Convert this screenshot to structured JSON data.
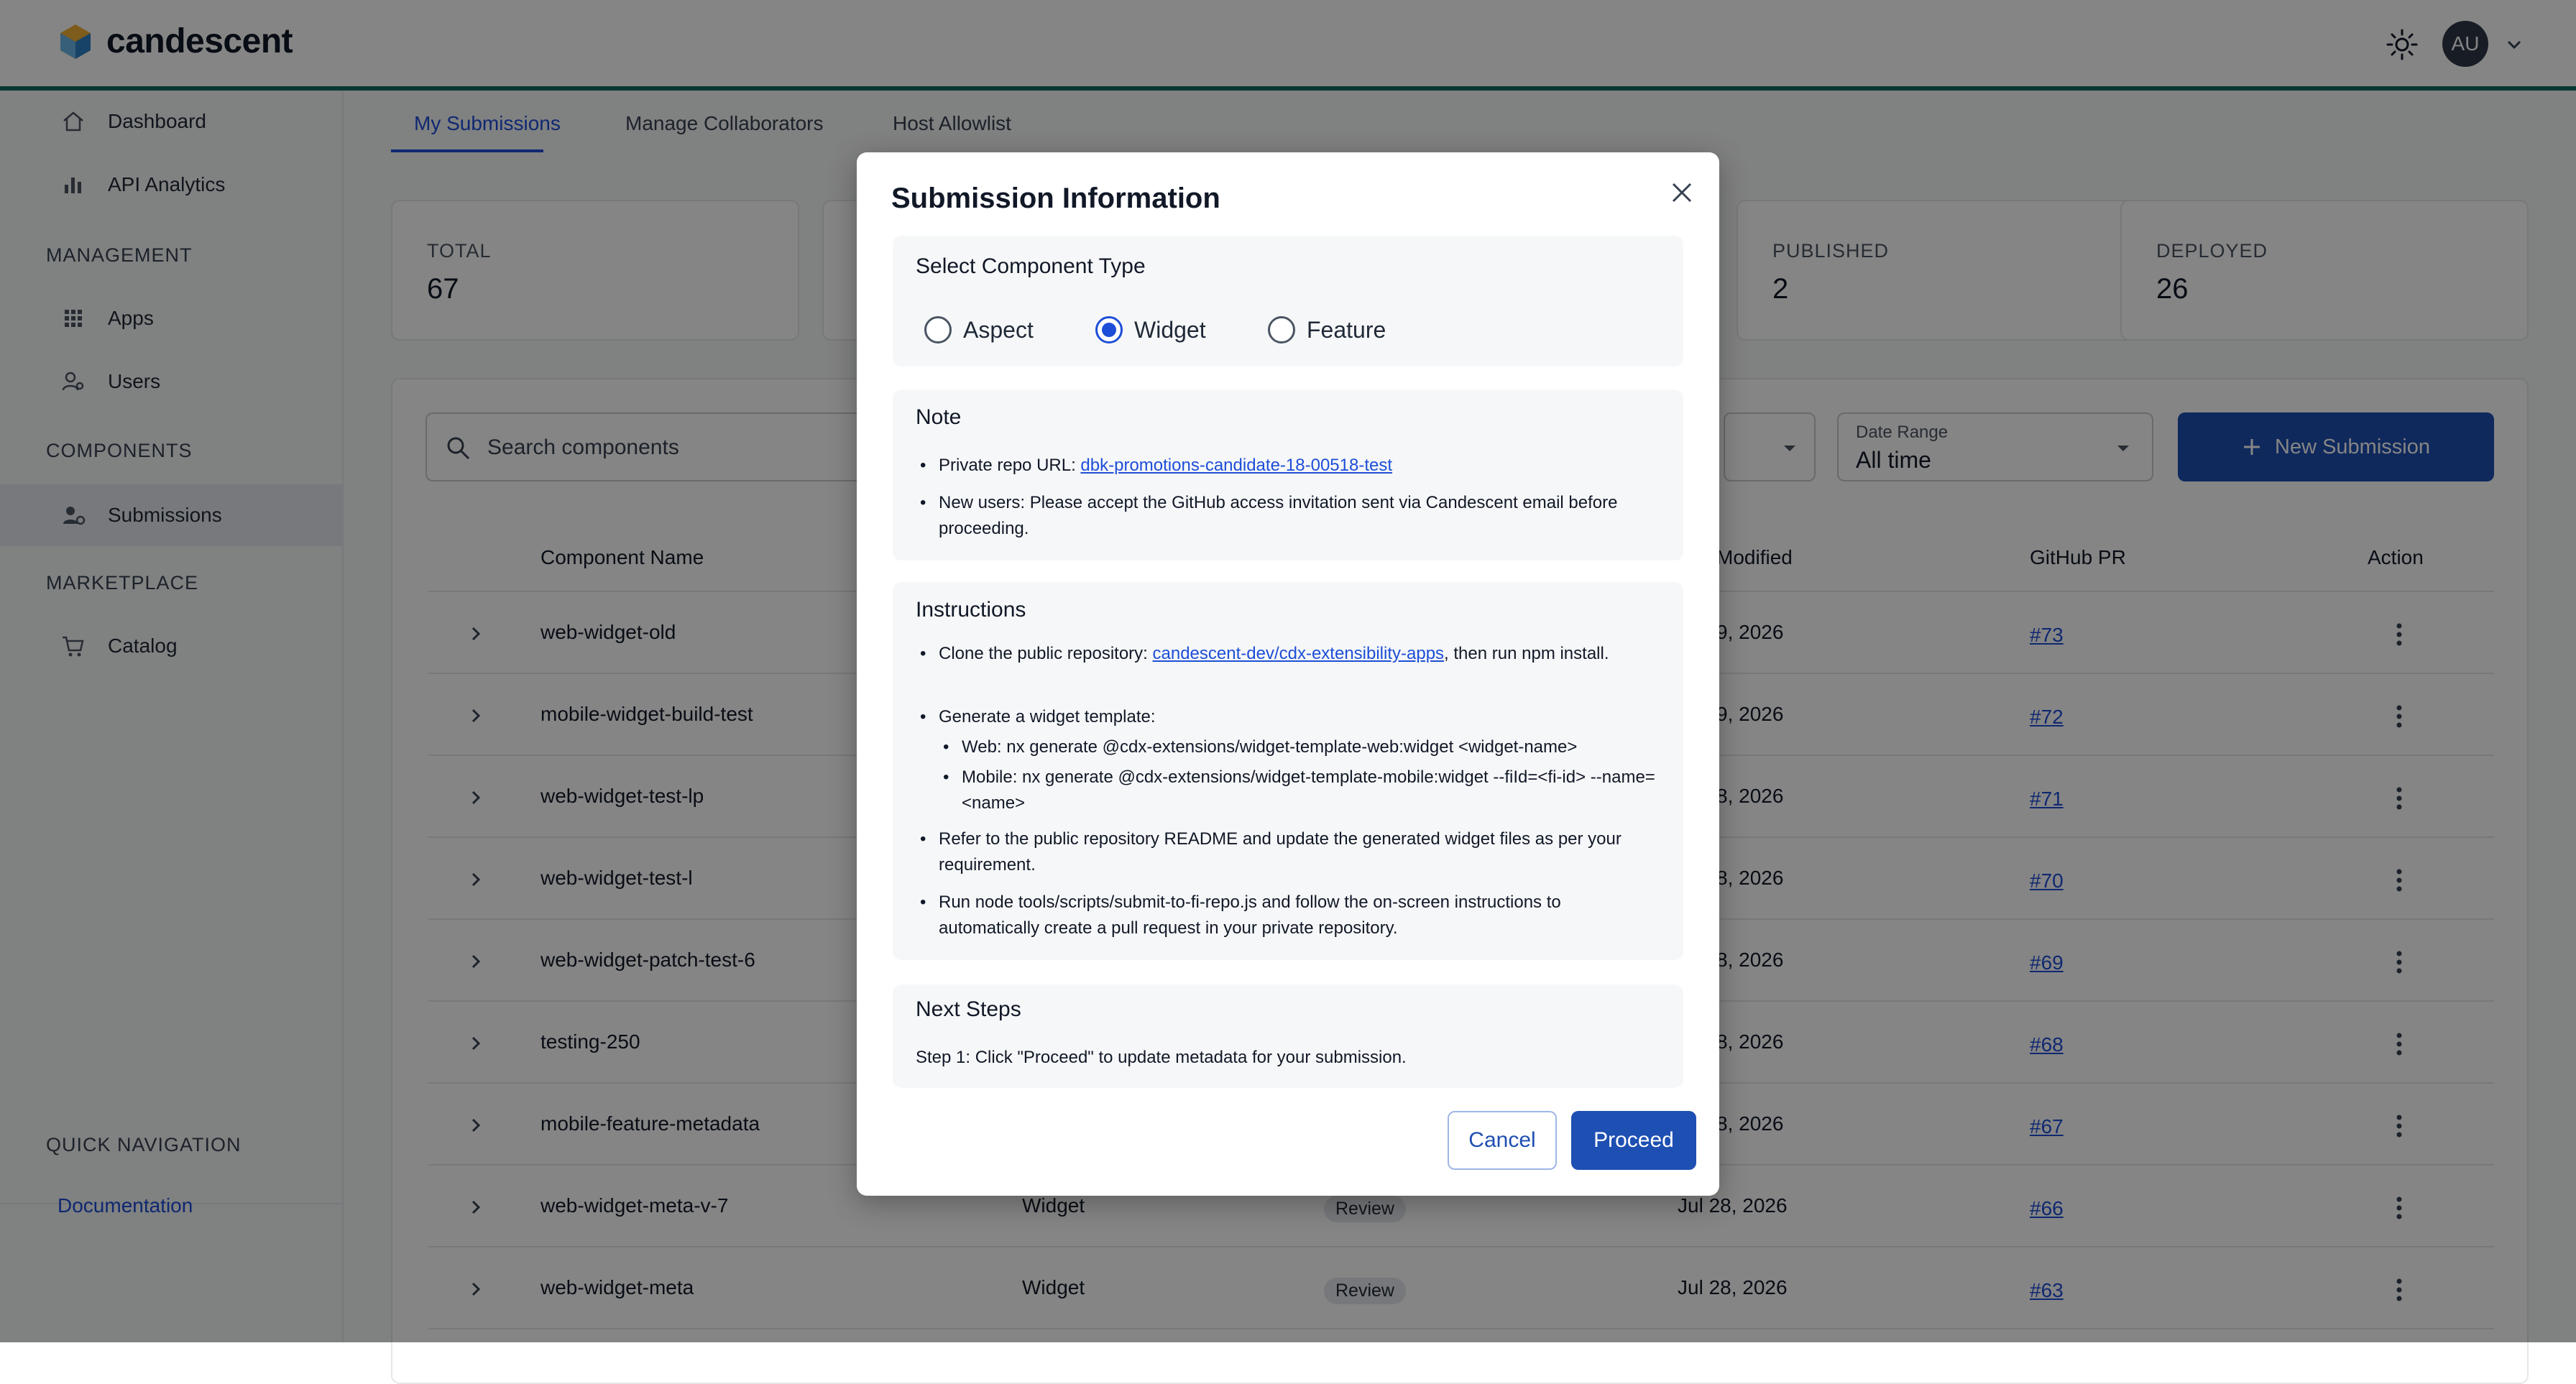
{
  "app": {
    "brand": "candescent",
    "avatar_initials": "AU",
    "accent_color": "#1e4fb2",
    "header_line_color": "#0e6b63"
  },
  "sidebar": {
    "items_top": [
      {
        "label": "Dashboard",
        "icon": "home-icon"
      },
      {
        "label": "API Analytics",
        "icon": "bar-chart-icon"
      }
    ],
    "management_label": "MANAGEMENT",
    "management_items": [
      {
        "label": "Apps",
        "icon": "grid-icon"
      },
      {
        "label": "Users",
        "icon": "users-icon"
      }
    ],
    "components_label": "COMPONENTS",
    "components_items": [
      {
        "label": "Submissions",
        "icon": "user-gear-icon"
      }
    ],
    "marketplace_label": "MARKETPLACE",
    "marketplace_items": [
      {
        "label": "Catalog",
        "icon": "cart-icon"
      }
    ],
    "quick_nav_label": "QUICK NAVIGATION",
    "documentation_link": "Documentation"
  },
  "tabs": [
    "My Submissions",
    "Manage Collaborators",
    "Host Allowlist"
  ],
  "stats": [
    {
      "title": "TOTAL",
      "value": "67"
    },
    {
      "title": "PUBLISHED",
      "value": "2"
    },
    {
      "title": "DEPLOYED",
      "value": "26"
    }
  ],
  "toolbar": {
    "search_placeholder": "Search components",
    "date_range_label": "Date Range",
    "date_range_value": "All time",
    "new_submission_label": "New Submission"
  },
  "table": {
    "headers": {
      "name": "Component Name",
      "modified": "Modified",
      "pr": "GitHub PR",
      "action": "Action"
    },
    "rows": [
      {
        "name": "web-widget-old",
        "type": "",
        "status": "",
        "modified": "9, 2026",
        "pr": "#73"
      },
      {
        "name": "mobile-widget-build-test",
        "type": "",
        "status": "",
        "modified": "9, 2026",
        "pr": "#72"
      },
      {
        "name": "web-widget-test-lp",
        "type": "",
        "status": "",
        "modified": "8, 2026",
        "pr": "#71"
      },
      {
        "name": "web-widget-test-l",
        "type": "",
        "status": "",
        "modified": "8, 2026",
        "pr": "#70"
      },
      {
        "name": "web-widget-patch-test-6",
        "type": "",
        "status": "",
        "modified": "8, 2026",
        "pr": "#69"
      },
      {
        "name": "testing-250",
        "type": "",
        "status": "",
        "modified": "8, 2026",
        "pr": "#68"
      },
      {
        "name": "mobile-feature-metadata",
        "type": "",
        "status": "",
        "modified": "8, 2026",
        "pr": "#67"
      },
      {
        "name": "web-widget-meta-v-7",
        "type": "Widget",
        "status": "Review",
        "modified": "Jul 28, 2026",
        "pr": "#66"
      },
      {
        "name": "web-widget-meta",
        "type": "Widget",
        "status": "Review",
        "modified": "Jul 28, 2026",
        "pr": "#63"
      }
    ]
  },
  "modal": {
    "title": "Submission Information",
    "component_type_title": "Select Component Type",
    "options": [
      "Aspect",
      "Widget",
      "Feature"
    ],
    "selected_option": "Widget",
    "note_title": "Note",
    "note_repo_prefix": "Private repo URL: ",
    "note_repo_link": "dbk-promotions-candidate-18-00518-test",
    "note_users": "New users: Please accept the GitHub access invitation sent via Candescent email before proceeding.",
    "instructions_title": "Instructions",
    "instr_clone_prefix": "Clone the public repository: ",
    "instr_clone_link": "candescent-dev/cdx-extensibility-apps",
    "instr_clone_suffix": ", then run npm install.",
    "instr_generate": "Generate a widget template:",
    "instr_web": "Web: nx generate @cdx-extensions/widget-template-web:widget <widget-name>",
    "instr_mobile": "Mobile: nx generate @cdx-extensions/widget-template-mobile:widget --fiId=<fi-id> --name=<name>",
    "instr_refer": "Refer to the public repository README and update the generated widget files as per your requirement.",
    "instr_run": "Run node tools/scripts/submit-to-fi-repo.js and follow the on-screen instructions to automatically create a pull request in your private repository.",
    "next_steps_title": "Next Steps",
    "next_step_1": "Step 1: Click \"Proceed\" to update metadata for your submission.",
    "cancel_label": "Cancel",
    "proceed_label": "Proceed"
  }
}
